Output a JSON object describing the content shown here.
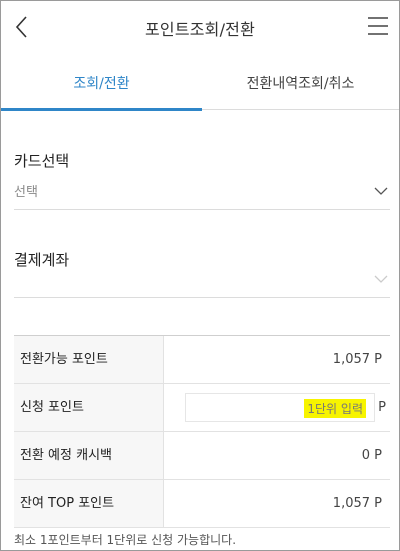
{
  "header": {
    "title": "포인트조회/전환"
  },
  "tabs": [
    {
      "label": "조회/전환",
      "active": true
    },
    {
      "label": "전환내역조회/취소",
      "active": false
    }
  ],
  "card": {
    "label": "카드선택",
    "value": "선택"
  },
  "account": {
    "label": "결제계좌",
    "value": ""
  },
  "table": {
    "convertible_label": "전환가능 포인트",
    "convertible_value": "1,057 P",
    "apply_label": "신청 포인트",
    "apply_placeholder": "1단위 입력",
    "apply_unit": "P",
    "expected_label": "전환 예정 캐시백",
    "expected_value": "0 P",
    "remaining_label": "잔여 TOP 포인트",
    "remaining_value": "1,057 P"
  },
  "note": "최소 1포인트부터 1단위로 신청 가능합니다.",
  "colors": {
    "accent": "#2f86c8",
    "highlight": "#f7f400"
  }
}
